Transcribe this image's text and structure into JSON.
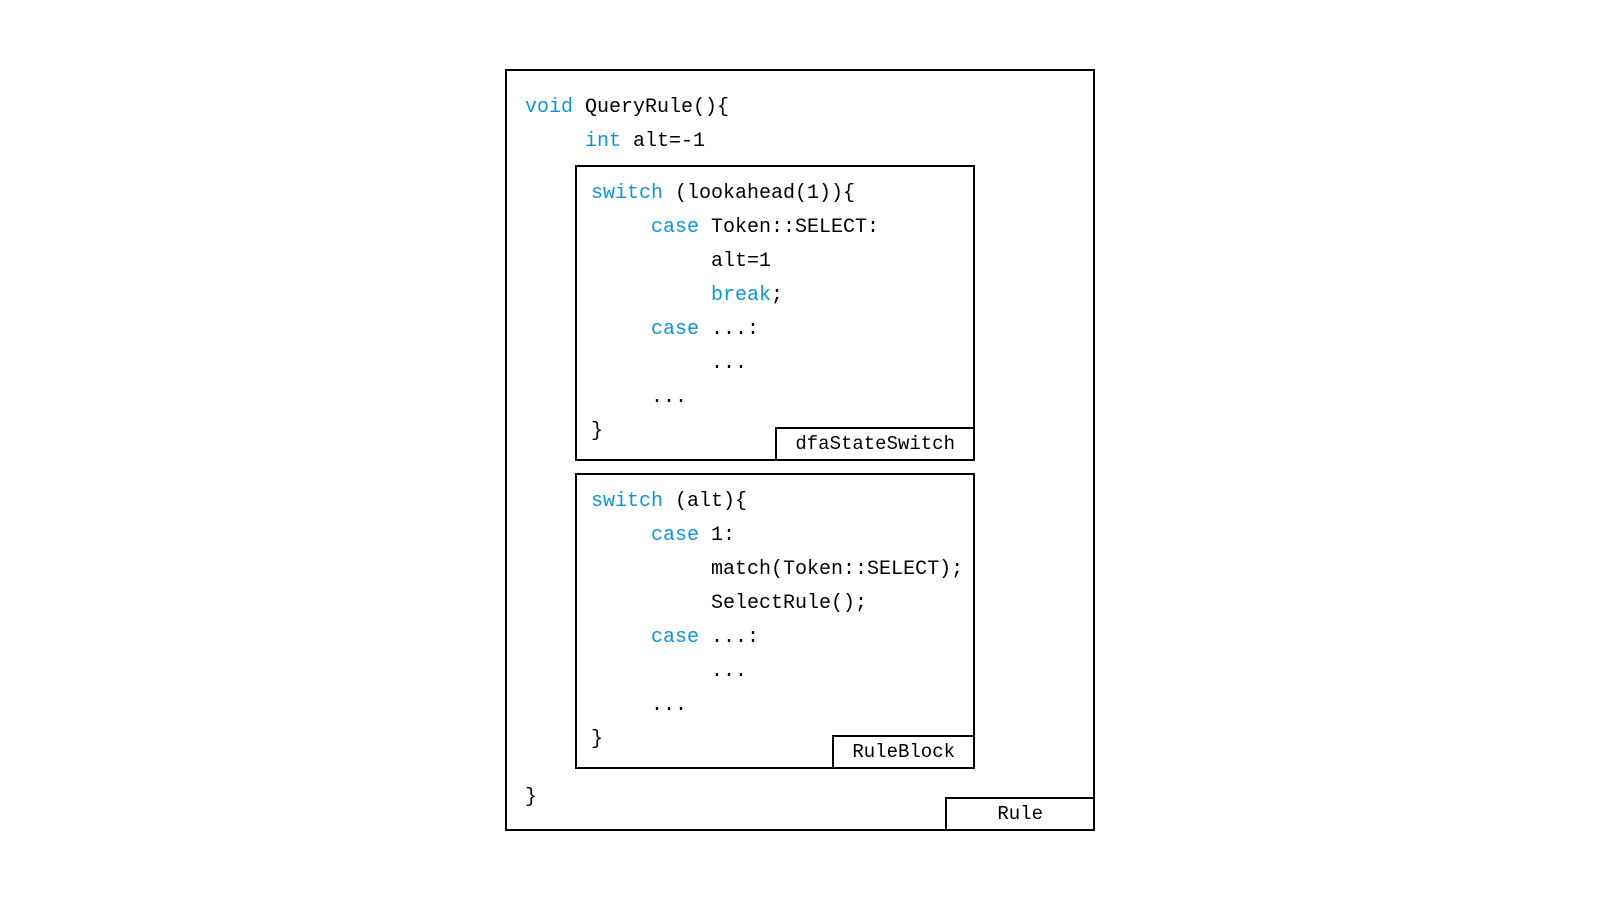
{
  "outer": {
    "signature_void": "void",
    "signature_name": " QueryRule(){",
    "decl_int": "int",
    "decl_rest": " alt=-1",
    "close": "}",
    "label": "Rule"
  },
  "box1": {
    "line1_kw": "switch",
    "line1_rest": " (lookahead(1)){",
    "line2_kw": "case",
    "line2_rest": " Token::SELECT:",
    "line3": "alt=1",
    "line4_kw": "break",
    "line4_rest": ";",
    "line5_kw": "case",
    "line5_rest": " ...:",
    "line6": "...",
    "line7": "...",
    "line8": "}",
    "label": "dfaStateSwitch"
  },
  "box2": {
    "line1_kw": "switch",
    "line1_rest": " (alt){",
    "line2_kw": "case",
    "line2_rest": " 1:",
    "line3": "match(Token::SELECT);",
    "line4": "SelectRule();",
    "line5_kw": "case",
    "line5_rest": " ...:",
    "line6": "...",
    "line7": "...",
    "line8": "}",
    "label": "RuleBlock"
  }
}
